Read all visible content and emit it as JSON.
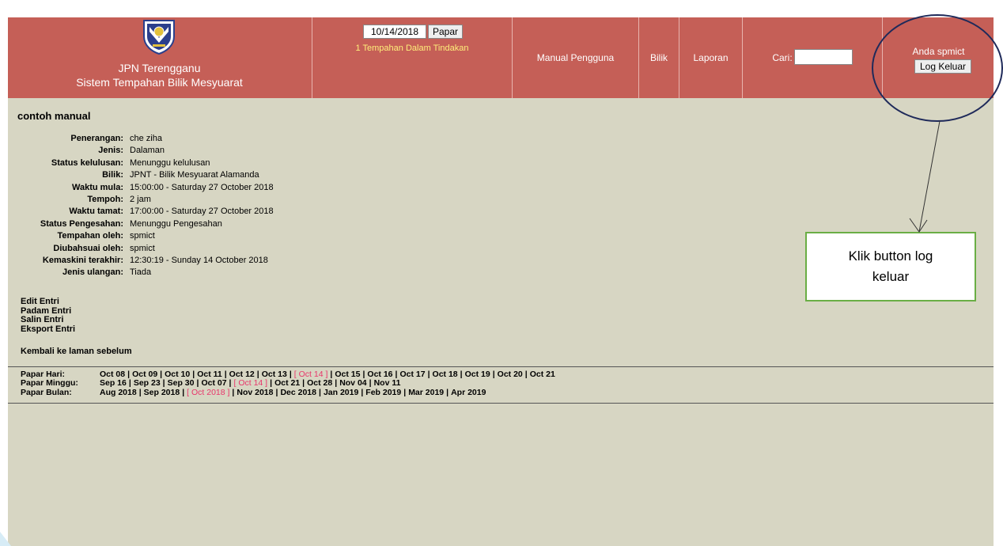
{
  "banner": {
    "line1": "JPN Terengganu",
    "line2": "Sistem Tempahan Bilik Mesyuarat",
    "logo_icon": "jpn-crest-logo",
    "date_value": "10/14/2018",
    "papar_label": "Papar",
    "pending": "1 Tempahan Dalam Tindakan",
    "nav": {
      "manual": "Manual Pengguna",
      "bilik": "Bilik",
      "laporan": "Laporan"
    },
    "cari_label": "Cari:",
    "cari_value": "",
    "user_text": "Anda spmict",
    "logout_label": "Log Keluar",
    "bg_color": "#c55f57"
  },
  "entry": {
    "title": "contoh manual",
    "fields": [
      {
        "label": "Penerangan:",
        "value": "che ziha"
      },
      {
        "label": "Jenis:",
        "value": "Dalaman"
      },
      {
        "label": "Status kelulusan:",
        "value": "Menunggu kelulusan"
      },
      {
        "label": "Bilik:",
        "value": "JPNT - Bilik Mesyuarat Alamanda"
      },
      {
        "label": "Waktu mula:",
        "value": "15:00:00 - Saturday 27 October 2018"
      },
      {
        "label": "Tempoh:",
        "value": "2 jam"
      },
      {
        "label": "Waktu tamat:",
        "value": "17:00:00 - Saturday 27 October 2018"
      },
      {
        "label": "Status Pengesahan:",
        "value": "Menunggu Pengesahan"
      },
      {
        "label": "Tempahan oleh:",
        "value": "spmict"
      },
      {
        "label": "Diubahsuai oleh:",
        "value": "spmict"
      },
      {
        "label": "Kemaskini terakhir:",
        "value": "12:30:19 - Sunday 14 October 2018"
      },
      {
        "label": "Jenis ulangan:",
        "value": "Tiada"
      }
    ],
    "actions": [
      "Edit Entri",
      "Padam Entri",
      "Salin Entri",
      "Eksport Entri"
    ],
    "back": "Kembali ke laman sebelum"
  },
  "navigation": {
    "hari": {
      "label": "Papar Hari:",
      "items": [
        "Oct 08",
        "Oct 09",
        "Oct 10",
        "Oct 11",
        "Oct 12",
        "Oct 13",
        "[ Oct 14 ]",
        "Oct 15",
        "Oct 16",
        "Oct 17",
        "Oct 18",
        "Oct 19",
        "Oct 20",
        "Oct 21"
      ],
      "current": 6
    },
    "minggu": {
      "label": "Papar Minggu:",
      "items": [
        "Sep 16",
        "Sep 23",
        "Sep 30",
        "Oct 07",
        "[ Oct 14 ]",
        "Oct 21",
        "Oct 28",
        "Nov 04",
        "Nov 11"
      ],
      "current": 4
    },
    "bulan": {
      "label": "Papar Bulan:",
      "items": [
        "Aug 2018",
        "Sep 2018",
        "[ Oct 2018 ]",
        "Nov 2018",
        "Dec 2018",
        "Jan 2019",
        "Feb 2019",
        "Mar 2019",
        "Apr 2019"
      ],
      "current": 2
    },
    "current_color": "#e8356a"
  },
  "annotation": {
    "callout": "Klik button log keluar",
    "circle_color": "#1f2a5a",
    "box_border_color": "#6aae45"
  }
}
